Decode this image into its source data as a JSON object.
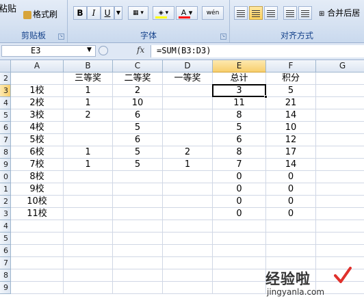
{
  "ribbon": {
    "clipboard": {
      "paste_label": "粘贴",
      "format_painter_label": "格式刷",
      "group_label": "剪贴板"
    },
    "font": {
      "bold_label": "B",
      "italic_label": "I",
      "underline_label": "U",
      "phonetic_label": "wén",
      "group_label": "字体",
      "fill_color": "#ffff00",
      "font_color": "#ff0000"
    },
    "alignment": {
      "merge_label": "合并后居",
      "group_label": "对齐方式"
    }
  },
  "formula_bar": {
    "name_box": "E3",
    "fx_label": "fx",
    "formula": "=SUM(B3:D3)"
  },
  "sheet": {
    "columns": [
      "A",
      "B",
      "C",
      "D",
      "E",
      "F",
      "G"
    ],
    "rows": [
      "2",
      "3",
      "4",
      "5",
      "6",
      "7",
      "8",
      "9",
      "0",
      "1",
      "2",
      "3",
      "4",
      "5",
      "6",
      "7",
      "8",
      "9"
    ],
    "active_column": "E",
    "active_row": "3",
    "cells": [
      [
        "",
        "三等奖",
        "二等奖",
        "一等奖",
        "总计",
        "积分",
        ""
      ],
      [
        "1校",
        "1",
        "2",
        "",
        "3",
        "5",
        ""
      ],
      [
        "2校",
        "1",
        "10",
        "",
        "11",
        "21",
        ""
      ],
      [
        "3校",
        "2",
        "6",
        "",
        "8",
        "14",
        ""
      ],
      [
        "4校",
        "",
        "5",
        "",
        "5",
        "10",
        ""
      ],
      [
        "5校",
        "",
        "6",
        "",
        "6",
        "12",
        ""
      ],
      [
        "6校",
        "1",
        "5",
        "2",
        "8",
        "17",
        ""
      ],
      [
        "7校",
        "1",
        "5",
        "1",
        "7",
        "14",
        ""
      ],
      [
        "8校",
        "",
        "",
        "",
        "0",
        "0",
        ""
      ],
      [
        "9校",
        "",
        "",
        "",
        "0",
        "0",
        ""
      ],
      [
        "10校",
        "",
        "",
        "",
        "0",
        "0",
        ""
      ],
      [
        "11校",
        "",
        "",
        "",
        "0",
        "0",
        ""
      ],
      [
        "",
        "",
        "",
        "",
        "",
        "",
        ""
      ],
      [
        "",
        "",
        "",
        "",
        "",
        "",
        ""
      ],
      [
        "",
        "",
        "",
        "",
        "",
        "",
        ""
      ],
      [
        "",
        "",
        "",
        "",
        "",
        "",
        ""
      ],
      [
        "",
        "",
        "",
        "",
        "",
        "",
        ""
      ],
      [
        "",
        "",
        "",
        "",
        "",
        "",
        ""
      ]
    ]
  },
  "watermark": {
    "title": "经验啦",
    "url": "jingyanla.com"
  }
}
